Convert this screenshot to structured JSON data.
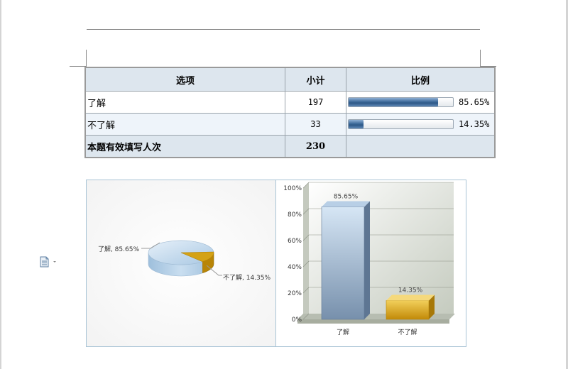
{
  "table": {
    "headers": [
      "选项",
      "小计",
      "比例"
    ],
    "rows": [
      {
        "option": "了解",
        "count": "197",
        "ratio": 85.65,
        "ratio_label": "85.65%"
      },
      {
        "option": "不了解",
        "count": "33",
        "ratio": 14.35,
        "ratio_label": "14.35%"
      }
    ],
    "total": {
      "label": "本题有效填写人次",
      "count": "230"
    }
  },
  "chart_data": [
    {
      "type": "pie",
      "categories": [
        "了解",
        "不了解"
      ],
      "values": [
        85.65,
        14.35
      ],
      "labels": [
        "了解, 85.65%",
        "不了解, 14.35%"
      ],
      "colors": [
        "#bcd6ea",
        "#d4a215"
      ]
    },
    {
      "type": "bar",
      "categories": [
        "了解",
        "不了解"
      ],
      "values": [
        85.65,
        14.35
      ],
      "value_labels": [
        "85.65%",
        "14.35%"
      ],
      "yticks": [
        "0%",
        "20%",
        "40%",
        "60%",
        "80%",
        "100%"
      ],
      "ylim": [
        0,
        100
      ],
      "grid": true,
      "colors": [
        "#7f9cb8",
        "#d4a215"
      ]
    }
  ],
  "icons": {
    "margin": "document-icon"
  }
}
